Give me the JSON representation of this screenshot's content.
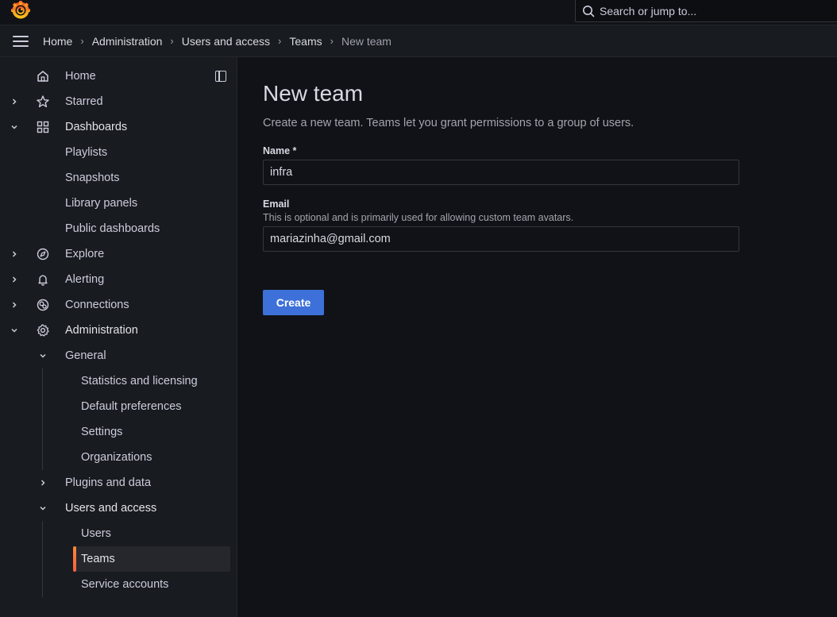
{
  "topbar": {
    "search_placeholder": "Search or jump to..."
  },
  "breadcrumbs": [
    {
      "label": "Home"
    },
    {
      "label": "Administration"
    },
    {
      "label": "Users and access"
    },
    {
      "label": "Teams"
    },
    {
      "label": "New team"
    }
  ],
  "sidebar": {
    "home": "Home",
    "starred": "Starred",
    "dashboards": "Dashboards",
    "playlists": "Playlists",
    "snapshots": "Snapshots",
    "library_panels": "Library panels",
    "public_dashboards": "Public dashboards",
    "explore": "Explore",
    "alerting": "Alerting",
    "connections": "Connections",
    "administration": "Administration",
    "general": "General",
    "statistics": "Statistics and licensing",
    "default_prefs": "Default preferences",
    "settings": "Settings",
    "organizations": "Organizations",
    "plugins": "Plugins and data",
    "users_access": "Users and access",
    "users": "Users",
    "teams": "Teams",
    "service_accounts": "Service accounts"
  },
  "form": {
    "title": "New team",
    "subtitle": "Create a new team. Teams let you grant permissions to a group of users.",
    "name_label": "Name *",
    "name_value": "infra",
    "email_label": "Email",
    "email_desc": "This is optional and is primarily used for allowing custom team avatars.",
    "email_value": "mariazinha@gmail.com",
    "create_label": "Create"
  },
  "colors": {
    "accent": "#3d71d9",
    "active_indicator": "#ff8833",
    "background": "#111217",
    "panel": "#181b1f"
  }
}
